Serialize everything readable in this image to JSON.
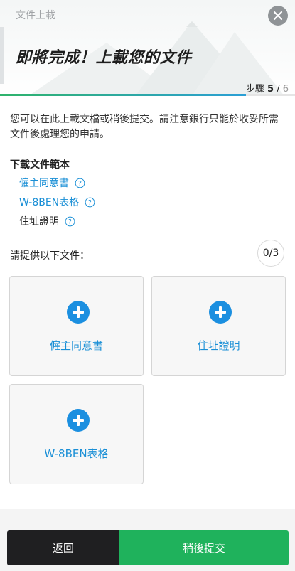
{
  "header": {
    "title": "文件上載",
    "headline": "即將完成！上載您的文件",
    "step_label": "步驟",
    "step_current": "5",
    "step_separator": "/",
    "step_total": "6",
    "progress_fraction": 0.833
  },
  "intro_text": "您可以在此上載文檔或稍後提交。請注意銀行只能於收妥所需文件後處理您的申請。",
  "templates": {
    "heading": "下載文件範本",
    "items": [
      {
        "label": "僱主同意書",
        "link": true
      },
      {
        "label": "W-8BEN表格",
        "link": true
      },
      {
        "label": "住址證明",
        "link": false
      }
    ]
  },
  "documents": {
    "heading": "請提供以下文件：",
    "counter": "0/3",
    "cards": [
      {
        "label": "僱主同意書"
      },
      {
        "label": "住址證明"
      },
      {
        "label": "W-8BEN表格"
      }
    ]
  },
  "footer": {
    "back_label": "返回",
    "later_label": "稍後提交"
  },
  "colors": {
    "accent_blue": "#1b8fe0",
    "link_blue": "#1a8fd6",
    "primary_green": "#1fb25c",
    "dark_button": "#1f1f21"
  },
  "icons": [
    "close-icon",
    "help-icon",
    "plus-icon"
  ]
}
